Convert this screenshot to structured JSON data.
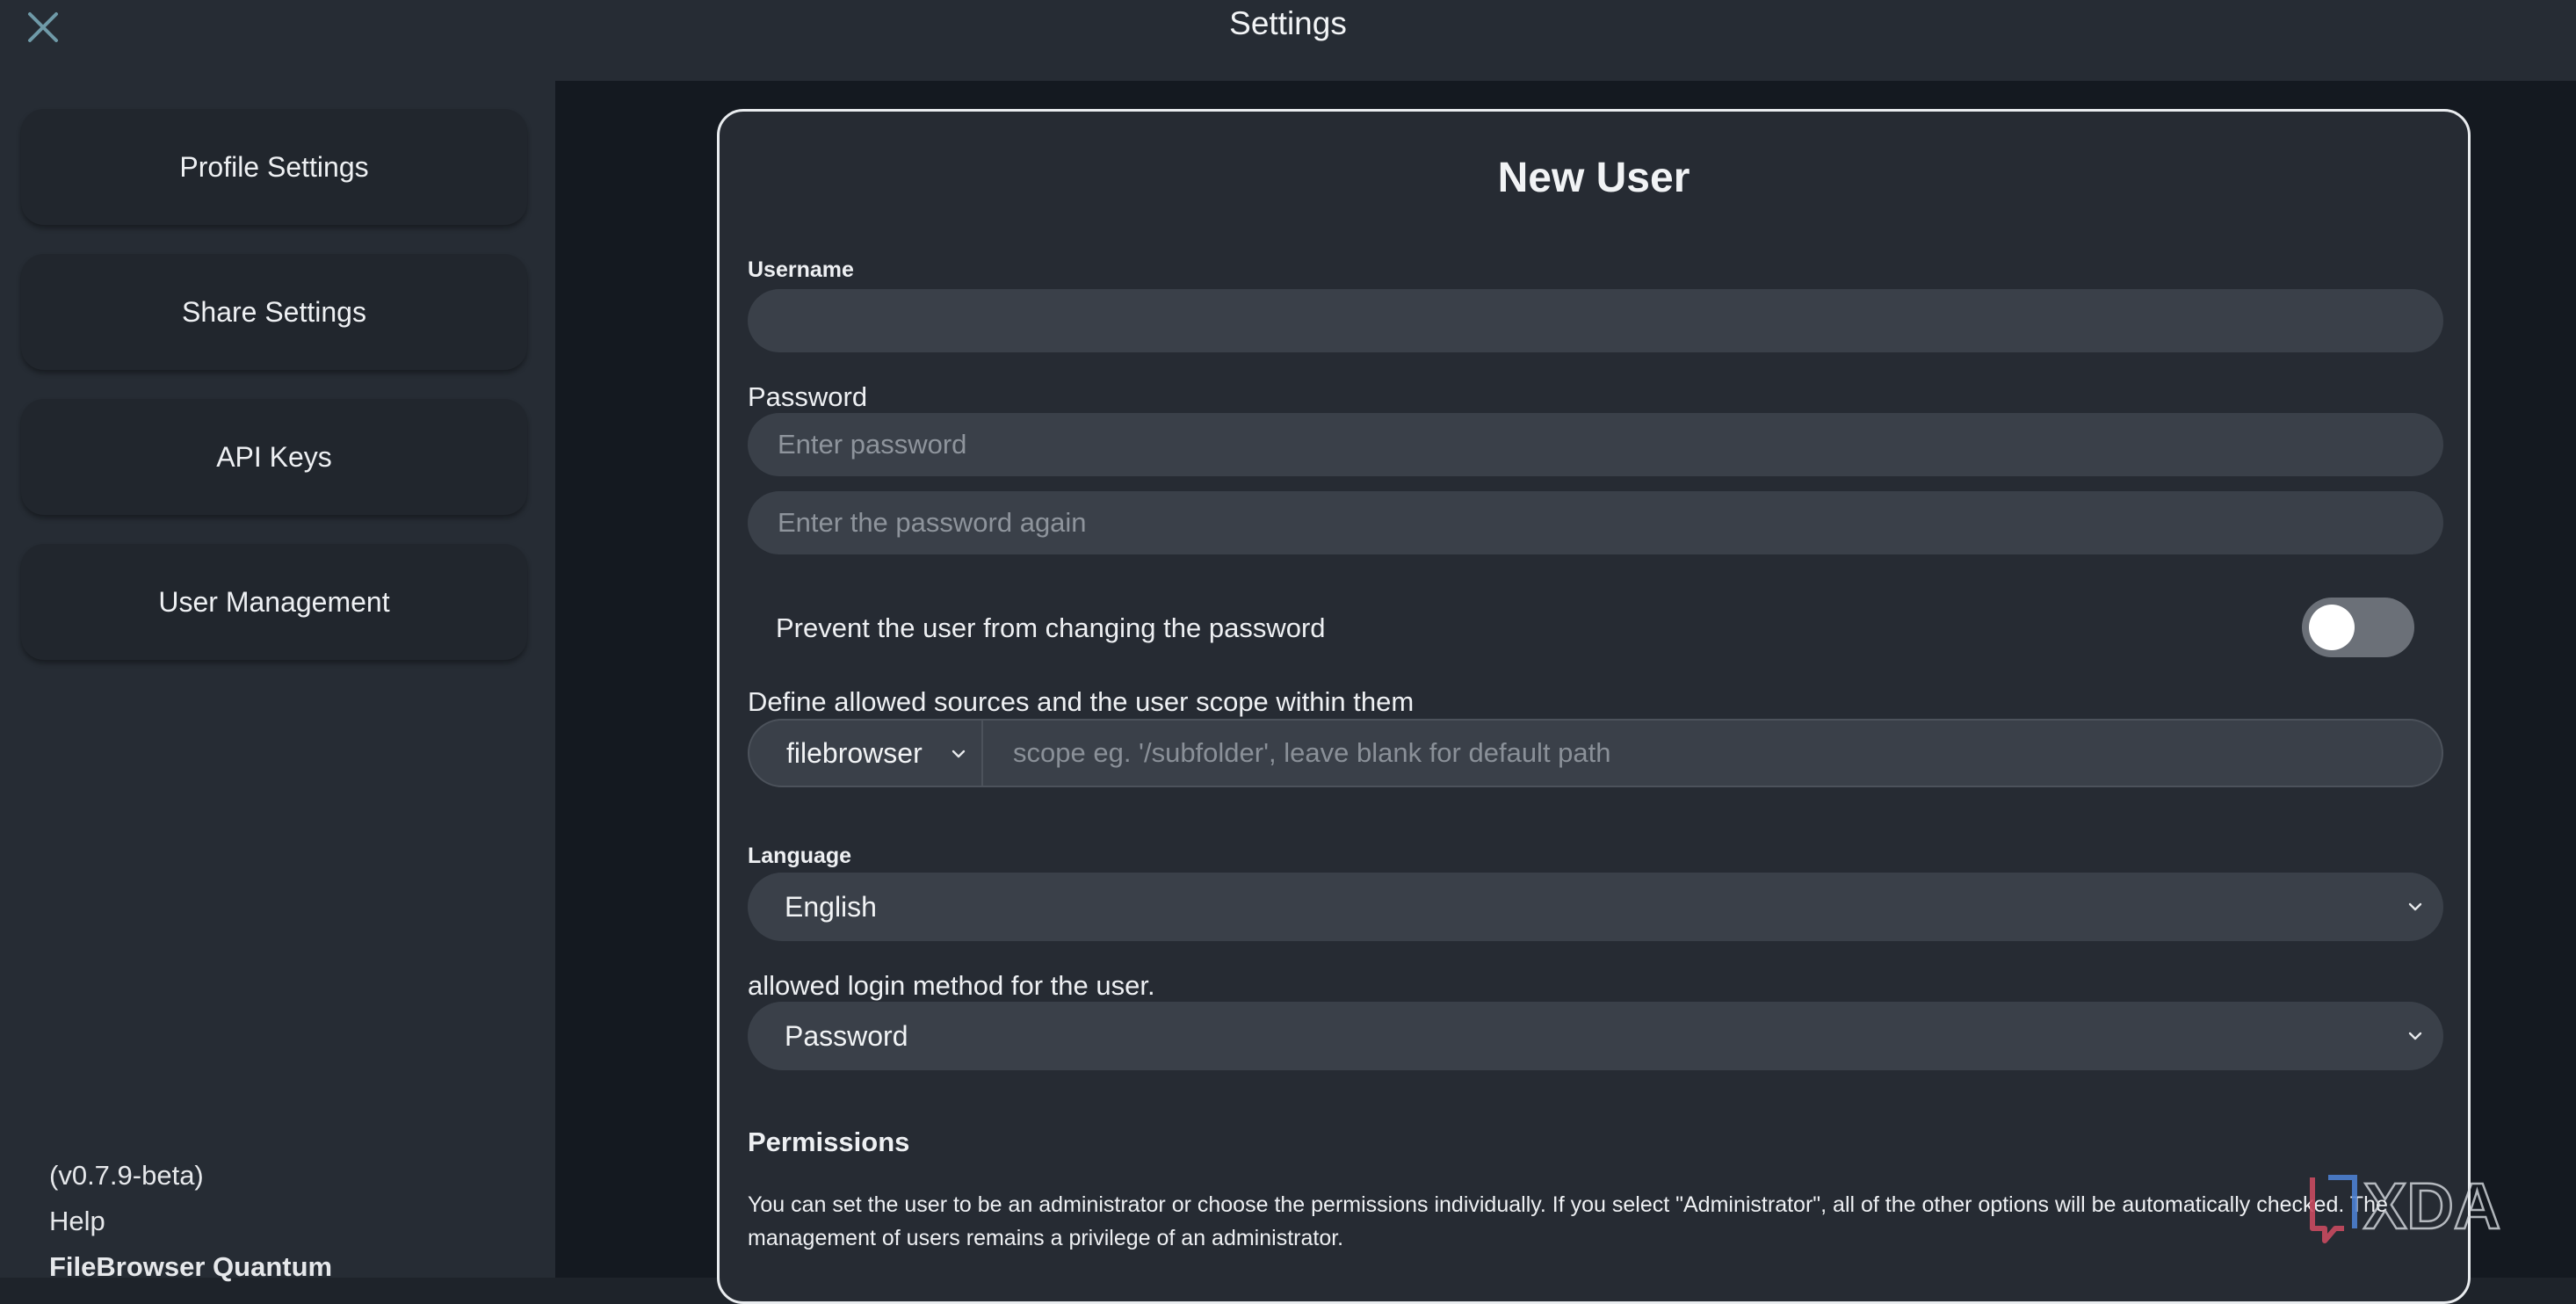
{
  "window": {
    "title": "Settings",
    "close_icon": "close-icon"
  },
  "sidebar": {
    "items": [
      {
        "label": "Profile Settings"
      },
      {
        "label": "Share Settings"
      },
      {
        "label": "API Keys"
      },
      {
        "label": "User Management"
      }
    ],
    "footer": {
      "version": "(v0.7.9-beta)",
      "help": "Help",
      "app_name": "FileBrowser Quantum"
    }
  },
  "form": {
    "title": "New User",
    "username": {
      "label": "Username",
      "value": "",
      "placeholder": ""
    },
    "password": {
      "label": "Password",
      "placeholder": "Enter password",
      "confirm_placeholder": "Enter the password again"
    },
    "prevent_password_change": {
      "label": "Prevent the user from changing the password",
      "enabled": false
    },
    "sources": {
      "label": "Define allowed sources and the user scope within them",
      "selected_source": "filebrowser",
      "scope_placeholder": "scope eg. '/subfolder', leave blank for default path"
    },
    "language": {
      "label": "Language",
      "selected": "English"
    },
    "login_method": {
      "label": "allowed login method for the user.",
      "selected": "Password"
    },
    "permissions": {
      "heading": "Permissions",
      "description": "You can set the user to be an administrator or choose the permissions individually. If you select \"Administrator\", all of the other options will be automatically checked. The management of users remains a privilege of an administrator."
    }
  },
  "watermark": {
    "text": "XDA"
  },
  "colors": {
    "topbar_bg": "#262c34",
    "sidebar_bg": "#262c34",
    "main_bg": "#141920",
    "card_bg": "#262b33",
    "field_bg": "#3a4049",
    "close_icon": "#6f9aa8"
  }
}
